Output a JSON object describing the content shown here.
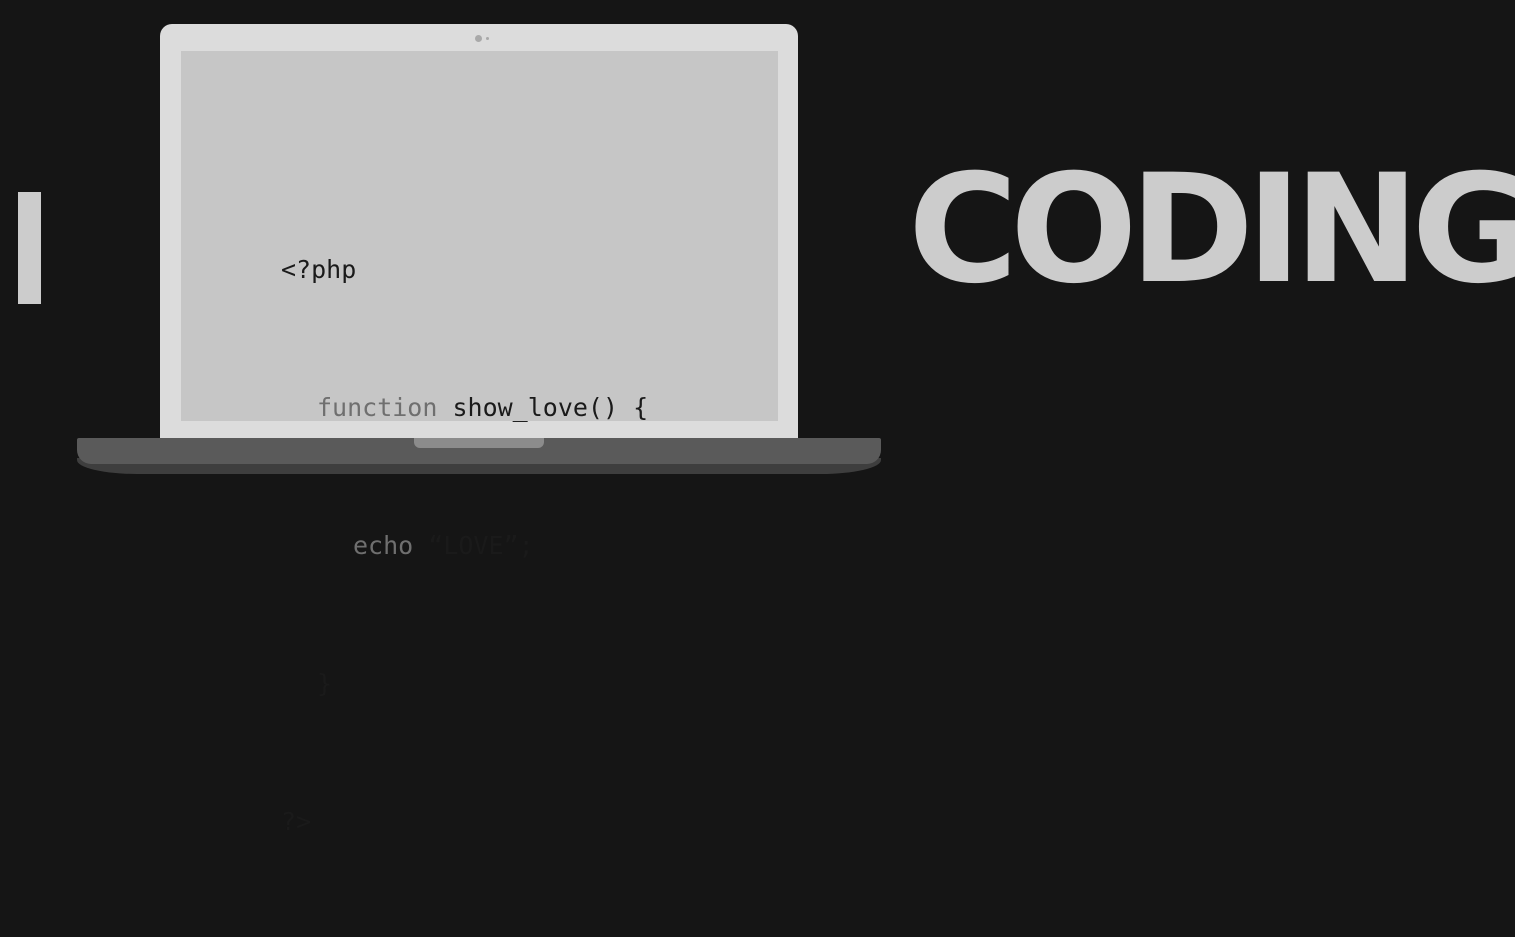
{
  "headline": {
    "left_word": "I",
    "right_word": "CODING"
  },
  "code": {
    "lines": [
      {
        "keyword": "",
        "text": "<?php"
      },
      {
        "keyword": "function",
        "text": " show_love() {"
      },
      {
        "keyword": "echo",
        "text": " “LOVE”;"
      },
      {
        "keyword": "",
        "text": "}"
      },
      {
        "keyword": "",
        "text": "?>"
      }
    ]
  },
  "colors": {
    "background": "#151515",
    "text_light": "#cccccc",
    "laptop_bezel": "#dcdcdc",
    "screen": "#c6c6c6",
    "code_text": "#1a1a1a",
    "code_keyword": "#6f6f6f",
    "laptop_base": "#5a5a5a"
  }
}
